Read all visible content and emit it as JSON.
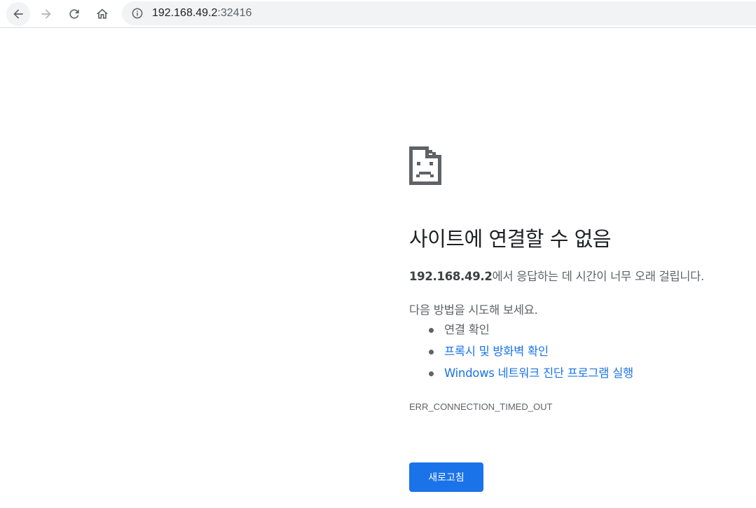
{
  "toolbar": {
    "url_host": "192.168.49.2",
    "url_port": ":32416"
  },
  "error": {
    "heading": "사이트에 연결할 수 없음",
    "summary_host": "192.168.49.2",
    "summary_rest": "에서 응답하는 데 시간이 너무 오래 걸립니다.",
    "suggestions_title": "다음 방법을 시도해 보세요.",
    "suggestions": [
      {
        "label": "연결 확인",
        "link": false
      },
      {
        "label": "프록시 및 방화벽 확인",
        "link": true
      },
      {
        "label": "Windows 네트워크 진단 프로그램 실행",
        "link": true
      }
    ],
    "code": "ERR_CONNECTION_TIMED_OUT",
    "reload_label": "새로고침"
  },
  "colors": {
    "accent": "#1a73e8",
    "text_secondary": "#5f6368",
    "omnibox_bg": "#f1f3f4"
  },
  "icons": [
    "back-arrow-icon",
    "forward-arrow-icon",
    "reload-icon",
    "home-icon",
    "info-icon",
    "sad-page-icon"
  ]
}
